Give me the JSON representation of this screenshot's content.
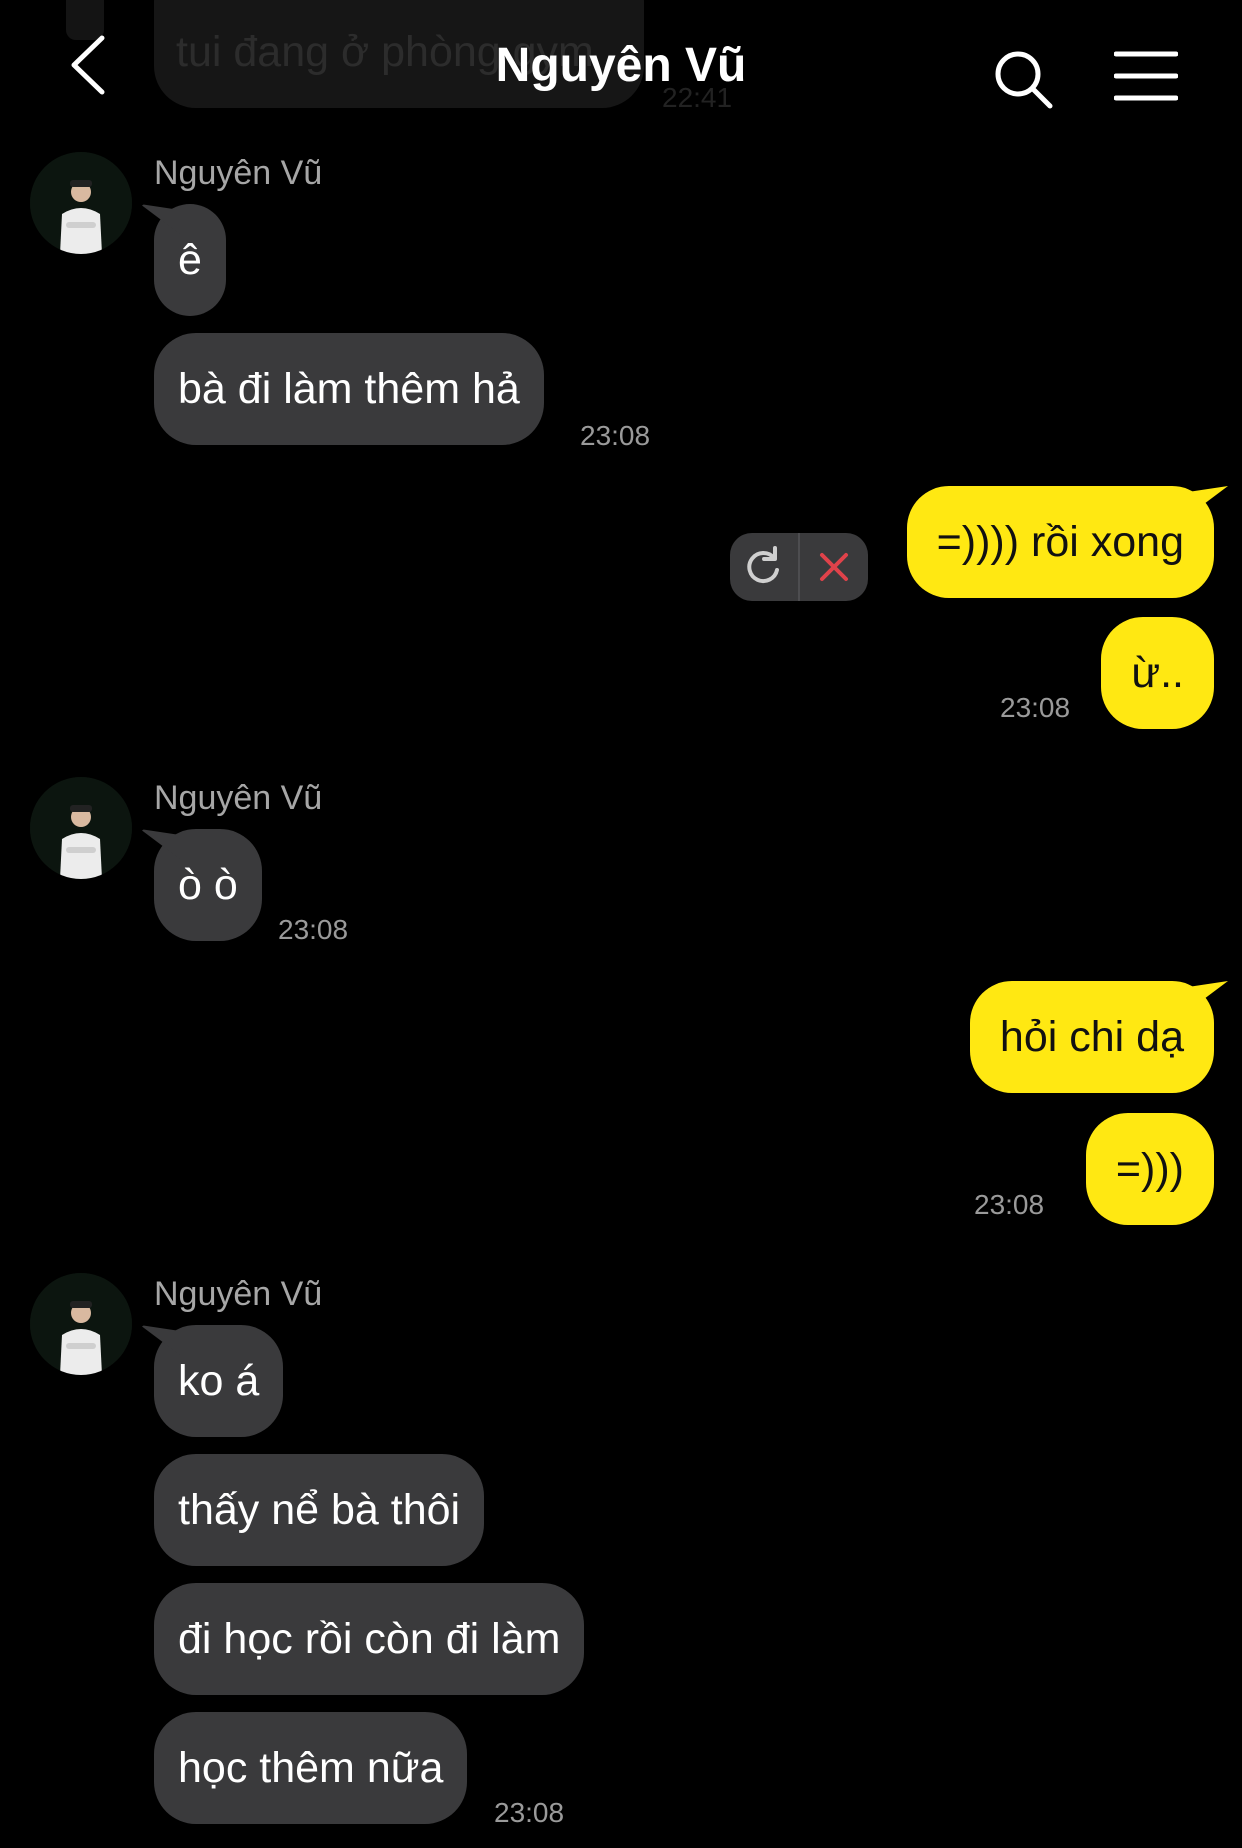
{
  "header": {
    "title": "Nguyên Vũ",
    "back_icon": "chevron-left-icon",
    "search_icon": "search-icon",
    "menu_icon": "hamburger-menu-icon"
  },
  "previous_message": {
    "text": "tui đang ở phòng gym",
    "time": "22:41"
  },
  "groups": [
    {
      "sender": "Nguyên Vũ",
      "messages": [
        "ê",
        "bà đi làm thêm hả"
      ],
      "time": "23:08"
    },
    {
      "messages": [
        "=)))) rồi xong",
        "ừ.."
      ],
      "time": "23:08",
      "retry_icon": "refresh-icon",
      "delete_icon": "close-icon"
    },
    {
      "sender": "Nguyên Vũ",
      "messages": [
        "ò ò"
      ],
      "time": "23:08"
    },
    {
      "messages": [
        "hỏi chi dạ",
        "=)))"
      ],
      "time": "23:08"
    },
    {
      "sender": "Nguyên Vũ",
      "messages": [
        "ko á",
        "thấy nể bà thôi",
        "đi học rồi còn đi làm",
        "học thêm nữa"
      ],
      "time": "23:08"
    }
  ],
  "colors": {
    "background": "#000000",
    "incoming_bubble": "#3a3a3c",
    "outgoing_bubble": "#ffe812",
    "timestamp": "#9a9a9a",
    "delete_x": "#e0424a"
  }
}
